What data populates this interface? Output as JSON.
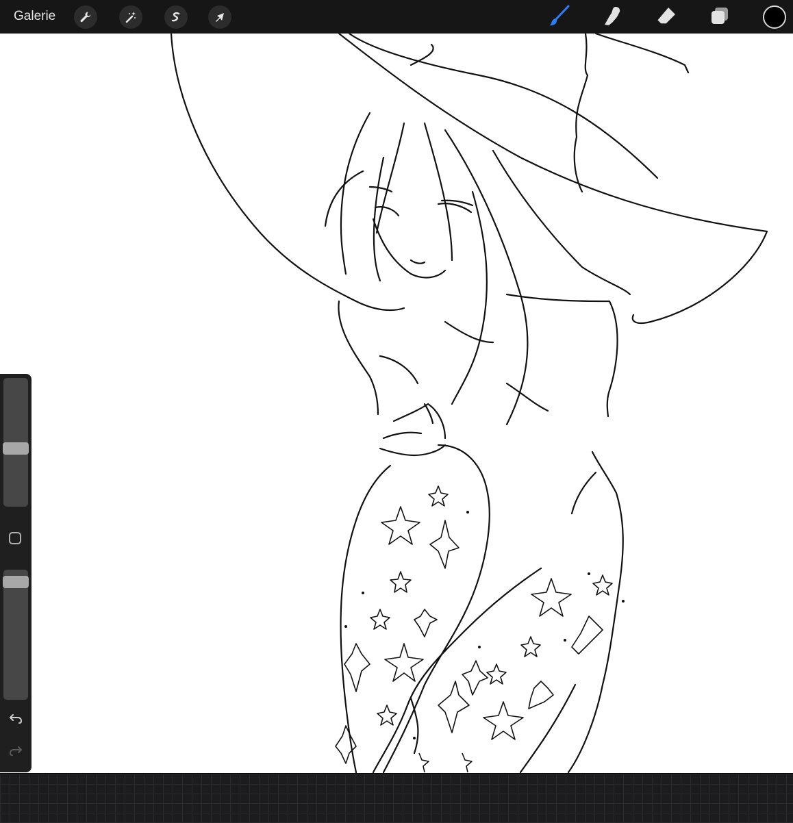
{
  "toolbar": {
    "gallery_label": "Galerie",
    "left_tools": [
      {
        "icon": "wrench-icon",
        "name": "actions"
      },
      {
        "icon": "magic-wand-icon",
        "name": "adjustments"
      },
      {
        "icon": "selection-icon",
        "name": "selection"
      },
      {
        "icon": "arrow-cursor-icon",
        "name": "transform"
      }
    ],
    "right_tools": [
      {
        "icon": "brush-icon",
        "name": "paint",
        "active": true
      },
      {
        "icon": "smudge-icon",
        "name": "smudge",
        "active": false
      },
      {
        "icon": "eraser-icon",
        "name": "erase",
        "active": false
      },
      {
        "icon": "layers-icon",
        "name": "layers",
        "active": false
      }
    ],
    "current_color": "#000000",
    "active_color": "#2f7cf6"
  },
  "sidebar": {
    "brush_size_level": 0.45,
    "opacity_level": 0.95
  },
  "canvas": {
    "content": "line-art-witch-drawing"
  }
}
